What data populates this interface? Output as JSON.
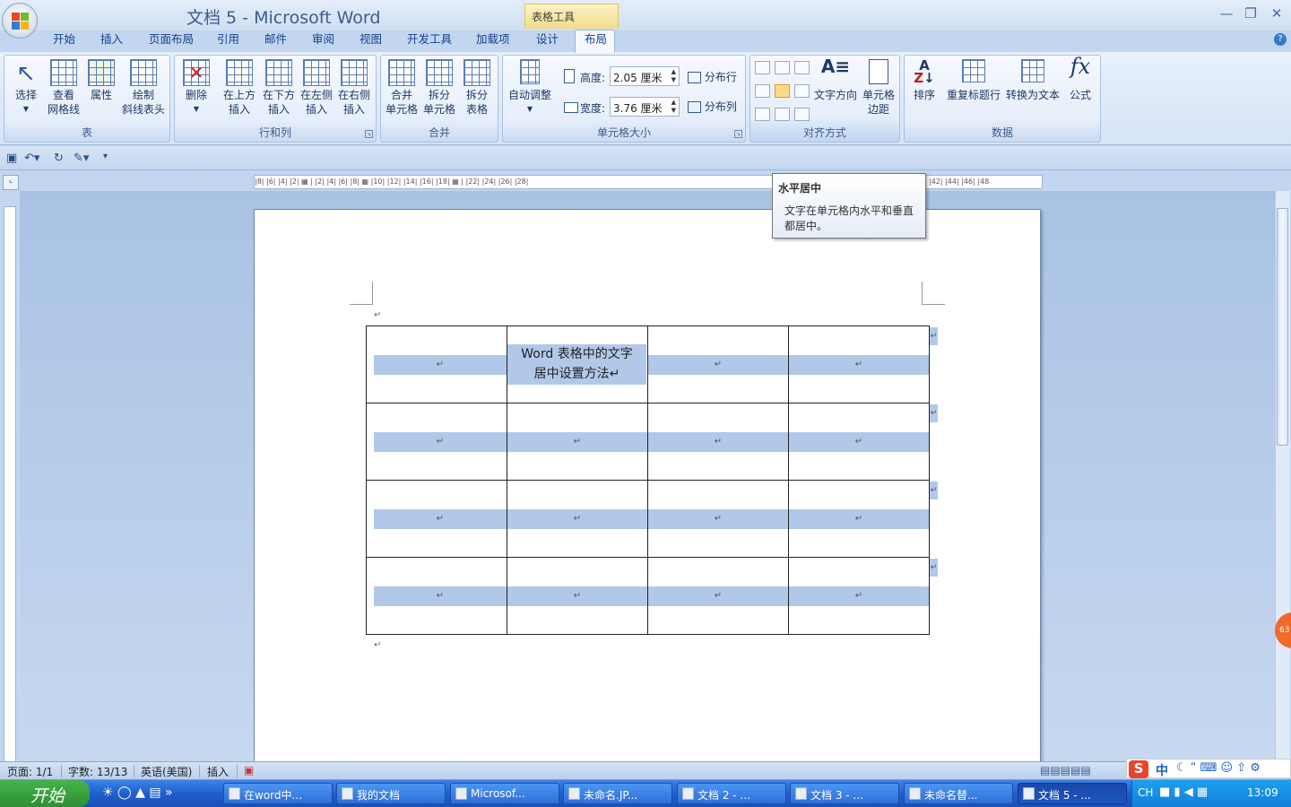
{
  "window": {
    "title": "文档 5 - Microsoft Word",
    "context_tab_group": "表格工具"
  },
  "tabs": [
    "开始",
    "插入",
    "页面布局",
    "引用",
    "邮件",
    "审阅",
    "视图",
    "开发工具",
    "加载项",
    "设计",
    "布局"
  ],
  "active_tab": "布局",
  "ribbon": {
    "groups": {
      "table": {
        "label": "表",
        "select": "选择",
        "gridlines1": "查看",
        "gridlines2": "网格线",
        "properties": "属性",
        "draw1": "绘制",
        "draw2": "斜线表头"
      },
      "rows_cols": {
        "label": "行和列",
        "delete": "删除",
        "above1": "在上方",
        "above2": "插入",
        "below1": "在下方",
        "below2": "插入",
        "left1": "在左侧",
        "left2": "插入",
        "right1": "在右侧",
        "right2": "插入"
      },
      "merge": {
        "label": "合并",
        "merge1": "合并",
        "merge2": "单元格",
        "split1": "拆分",
        "split2": "单元格",
        "splittable1": "拆分",
        "splittable2": "表格"
      },
      "cell_size": {
        "label": "单元格大小",
        "autofit": "自动调整",
        "height_label": "高度:",
        "height_value": "2.05 厘米",
        "width_label": "宽度:",
        "width_value": "3.76 厘米",
        "dist_rows": "分布行",
        "dist_cols": "分布列"
      },
      "alignment": {
        "label": "对齐方式",
        "text_dir": "文字方向",
        "margins1": "单元格",
        "margins2": "边距"
      },
      "data": {
        "label": "数据",
        "sort": "排序",
        "repeat": "重复标题行",
        "convert": "转换为文本",
        "formula": "公式"
      }
    }
  },
  "tooltip": {
    "title": "水平居中",
    "description": "文字在单元格内水平和垂直都居中。"
  },
  "ruler": {
    "h_text": "|8|  |6|  |4|  |2|  ▦  |  |2|  |4|  |6|  |8|  ▦  |10|  |12|  |14|  |16|  |18|  ▦  |  |22|  |24|  |26|  |28|",
    "h_text2": "|42|  |44|  |46|  |48"
  },
  "document": {
    "para_mark": "↵",
    "cell_text": "Word 表格中的文字居中设置方法",
    "cell_text_line1": "Word 表格中的文字",
    "cell_text_line2": "居中设置方法↵",
    "rows": 4,
    "cols": 4
  },
  "status": {
    "page": "页面: 1/1",
    "words": "字数: 13/13",
    "language": "英语(美国)",
    "mode": "插入"
  },
  "taskbar": {
    "start": "开始",
    "tasks": [
      "在word中...",
      "我的文档",
      "Microsof...",
      "未命名.JP...",
      "文档 2 - ...",
      "文档 3 - ...",
      "未命名替...",
      "文档 5 - ..."
    ],
    "lang": "CH",
    "clock": "13:09"
  },
  "ime": {
    "badge": "63",
    "mode": "中"
  },
  "colors": {
    "accent": "#15428b",
    "ribbon_bg": "#d6e4f6",
    "selected_cell": "#b1c8e8",
    "taskbar": "#1f5fcf"
  }
}
